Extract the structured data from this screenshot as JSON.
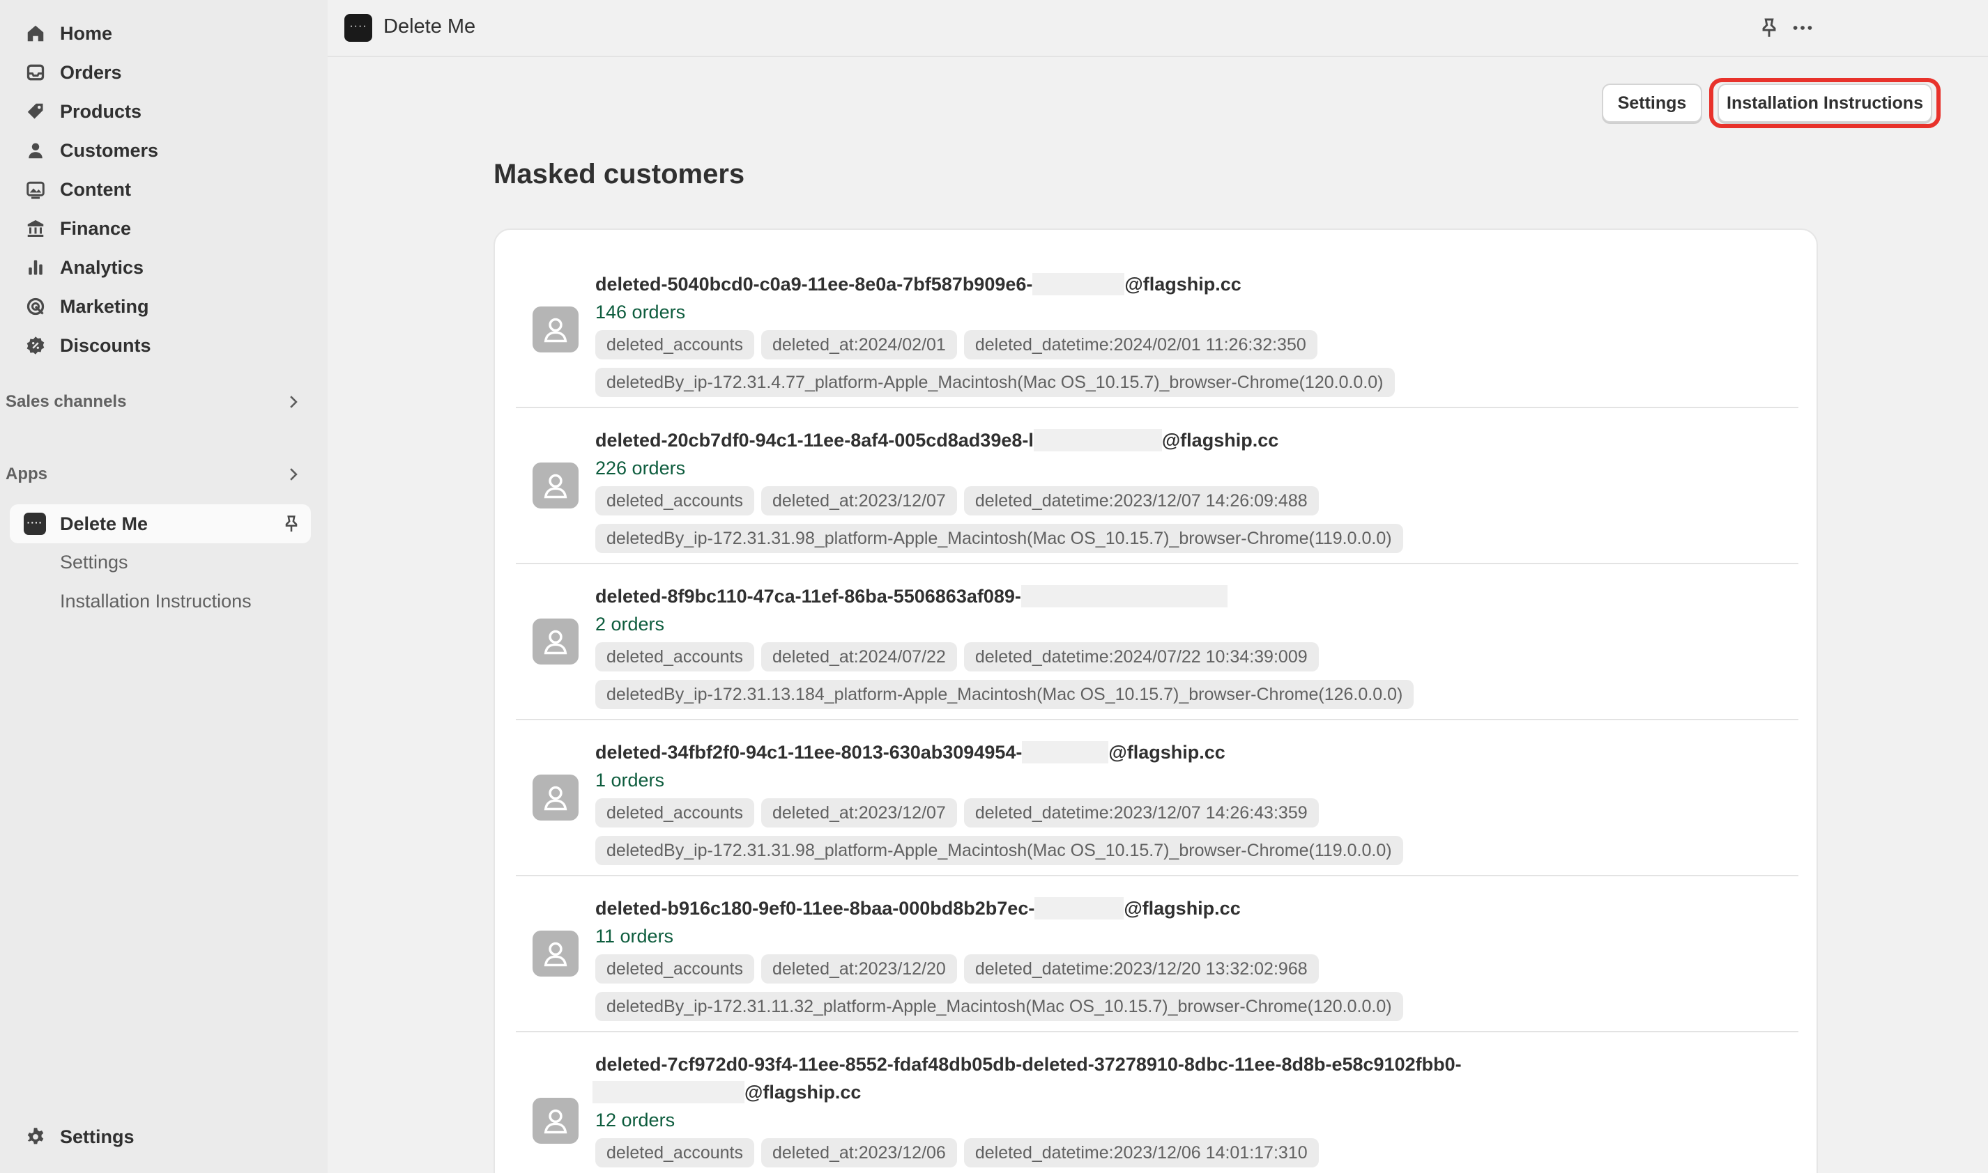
{
  "sidebar": {
    "items": [
      {
        "label": "Home",
        "icon": "home-icon"
      },
      {
        "label": "Orders",
        "icon": "inbox-icon"
      },
      {
        "label": "Products",
        "icon": "tag-icon"
      },
      {
        "label": "Customers",
        "icon": "person-icon"
      },
      {
        "label": "Content",
        "icon": "image-icon"
      },
      {
        "label": "Finance",
        "icon": "bank-icon"
      },
      {
        "label": "Analytics",
        "icon": "bar-chart-icon"
      },
      {
        "label": "Marketing",
        "icon": "target-icon"
      },
      {
        "label": "Discounts",
        "icon": "discount-icon"
      }
    ],
    "sales_channels": "Sales channels",
    "apps": "Apps",
    "active_app": "Delete Me",
    "app_subitems": [
      "Settings",
      "Installation Instructions"
    ],
    "settings": "Settings"
  },
  "topbar": {
    "title": "Delete Me"
  },
  "header": {
    "settings_button": "Settings",
    "install_button": "Installation Instructions",
    "highlight_color": "#e8322b"
  },
  "page_title": "Masked customers",
  "customers": [
    {
      "name_prefix": "deleted-5040bcd0-c0a9-11ee-8e0a-7bf587b909e6-",
      "name_suffix": "@flagship.cc",
      "orders": "146 orders",
      "tags": [
        "deleted_accounts",
        "deleted_at:2024/02/01",
        "deleted_datetime:2024/02/01 11:26:32:350",
        "deletedBy_ip-172.31.4.77_platform-Apple_Macintosh(Mac OS_10.15.7)_browser-Chrome(120.0.0.0)"
      ]
    },
    {
      "name_prefix": "deleted-20cb7df0-94c1-11ee-8af4-005cd8ad39e8-l",
      "name_suffix": "@flagship.cc",
      "orders": "226 orders",
      "tags": [
        "deleted_accounts",
        "deleted_at:2023/12/07",
        "deleted_datetime:2023/12/07 14:26:09:488",
        "deletedBy_ip-172.31.31.98_platform-Apple_Macintosh(Mac OS_10.15.7)_browser-Chrome(119.0.0.0)"
      ]
    },
    {
      "name_prefix": "deleted-8f9bc110-47ca-11ef-86ba-5506863af089-",
      "name_suffix": "",
      "orders": "2 orders",
      "tags": [
        "deleted_accounts",
        "deleted_at:2024/07/22",
        "deleted_datetime:2024/07/22 10:34:39:009",
        "deletedBy_ip-172.31.13.184_platform-Apple_Macintosh(Mac OS_10.15.7)_browser-Chrome(126.0.0.0)"
      ]
    },
    {
      "name_prefix": "deleted-34fbf2f0-94c1-11ee-8013-630ab3094954-",
      "name_suffix": "@flagship.cc",
      "orders": "1 orders",
      "tags": [
        "deleted_accounts",
        "deleted_at:2023/12/07",
        "deleted_datetime:2023/12/07 14:26:43:359",
        "deletedBy_ip-172.31.31.98_platform-Apple_Macintosh(Mac OS_10.15.7)_browser-Chrome(119.0.0.0)"
      ]
    },
    {
      "name_prefix": "deleted-b916c180-9ef0-11ee-8baa-000bd8b2b7ec-",
      "name_suffix": "@flagship.cc",
      "orders": "11 orders",
      "tags": [
        "deleted_accounts",
        "deleted_at:2023/12/20",
        "deleted_datetime:2023/12/20 13:32:02:968",
        "deletedBy_ip-172.31.11.32_platform-Apple_Macintosh(Mac OS_10.15.7)_browser-Chrome(120.0.0.0)"
      ]
    },
    {
      "name_prefix": "deleted-7cf972d0-93f4-11ee-8552-fdaf48db05db-deleted-37278910-8dbc-11ee-8d8b-e58c9102fbb0-",
      "name_suffix": "@flagship.cc",
      "orders": "12 orders",
      "tags": [
        "deleted_accounts",
        "deleted_at:2023/12/06",
        "deleted_datetime:2023/12/06 14:01:17:310"
      ]
    }
  ]
}
